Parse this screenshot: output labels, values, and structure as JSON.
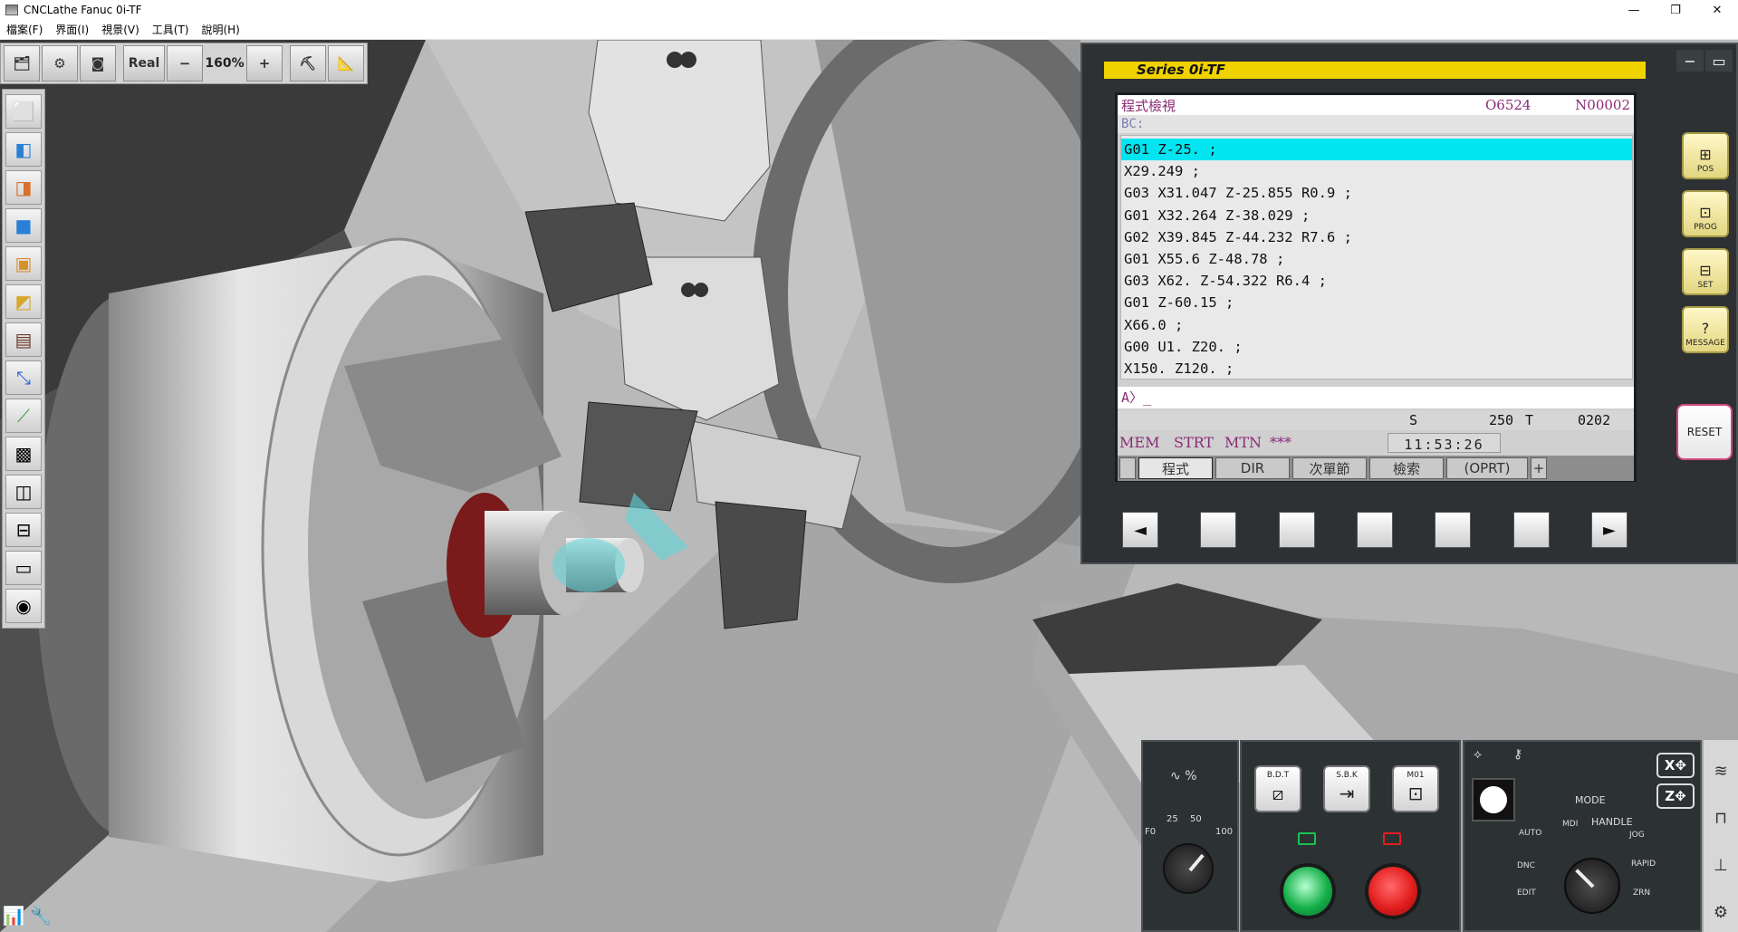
{
  "window": {
    "title": "CNCLathe Fanuc 0i-TF",
    "controls": [
      "—",
      "❐",
      "✕"
    ]
  },
  "menu": [
    "檔案(F)",
    "界面(I)",
    "視景(V)",
    "工具(T)",
    "說明(H)"
  ],
  "toolbar": {
    "real_label": "Real",
    "zoom_out": "−",
    "zoom_level": "160%",
    "zoom_in": "+"
  },
  "cnc": {
    "series": "Series 0i-TF",
    "screen": {
      "title": "程式檢視",
      "o_number": "O6524",
      "n_number": "N00002",
      "bc_label": "BC:",
      "program_lines": [
        "G01 Z-25. ;",
        "X29.249 ;",
        "G03 X31.047 Z-25.855 R0.9 ;",
        "G01 X32.264 Z-38.029 ;",
        "G02 X39.845 Z-44.232 R7.6 ;",
        "G01 X55.6 Z-48.78 ;",
        "G03 X62. Z-54.322 R6.4 ;",
        "G01 Z-60.15 ;",
        "X66.0 ;",
        "G00 U1. Z20. ;",
        "X150. Z120. ;"
      ],
      "active_line": 0,
      "input_prompt": "A〉_",
      "s_label": "S",
      "s_value": "250",
      "t_label": "T",
      "t_value": "0202",
      "status_mode": "MEM",
      "status_run": "STRT",
      "status_motion": "MTN",
      "status_alarm": "***",
      "clock": "11:53:26",
      "softkeys": [
        "程式",
        "DIR",
        "次單節",
        "檢索",
        "(OPRT)",
        "+"
      ]
    },
    "function_keys": [
      "◄",
      "",
      "",
      "",
      "",
      "",
      "►"
    ],
    "side_keys": [
      "POS",
      "PROG",
      "SET",
      "MESSAGE"
    ],
    "reset_label": "RESET"
  },
  "operator": {
    "feed": {
      "label": "%",
      "f0": "F0",
      "m25": "25",
      "m50": "50",
      "m100": "100"
    },
    "switches": [
      "B.D.T",
      "S.B.K",
      "M01"
    ],
    "mode": {
      "title": "MODE",
      "auto": "AUTO",
      "mdi": "MDI",
      "handle": "HANDLE",
      "jog": "JOG",
      "rapid": "RAPID",
      "zrn": "ZRN",
      "dnc": "DNC",
      "edit": "EDIT",
      "x_axis": "X",
      "z_axis": "Z"
    }
  },
  "colors": {
    "series_bar": "#f0d200",
    "active_line": "#00e5f0",
    "screen_text": "#8a2a76",
    "cycle_start": "#16b04a",
    "feed_hold": "#e31e1e"
  }
}
